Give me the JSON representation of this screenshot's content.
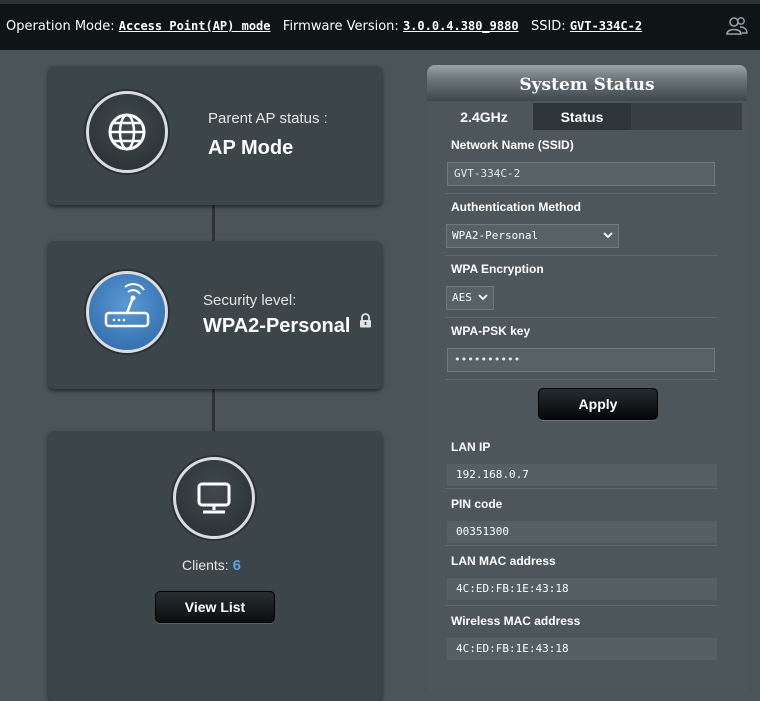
{
  "topbar": {
    "operation_mode_label": "Operation Mode:",
    "operation_mode_value": "Access Point(AP) mode",
    "firmware_label": "Firmware Version:",
    "firmware_value": "3.0.0.4.380_9880",
    "ssid_label": "SSID:",
    "ssid_value": "GVT-334C-2",
    "icon": "users-icon"
  },
  "parent_ap": {
    "icon": "globe-icon",
    "label": "Parent AP status :",
    "value": "AP Mode"
  },
  "security": {
    "icon": "router-icon",
    "label": "Security level:",
    "value": "WPA2-Personal",
    "lock_icon": "lock-icon"
  },
  "clients": {
    "icon": "monitor-icon",
    "label": "Clients:",
    "count": "6",
    "button_label": "View List"
  },
  "system_status": {
    "title": "System Status",
    "tabs": [
      {
        "label": "2.4GHz",
        "active": true
      },
      {
        "label": "Status",
        "active": false
      }
    ],
    "network_name_label": "Network Name (SSID)",
    "network_name_value": "GVT-334C-2",
    "auth_method_label": "Authentication Method",
    "auth_method_value": "WPA2-Personal",
    "wpa_encryption_label": "WPA Encryption",
    "wpa_encryption_value": "AES",
    "wpa_psk_label": "WPA-PSK key",
    "wpa_psk_value": "••••••••••",
    "apply_label": "Apply",
    "lan_ip_label": "LAN IP",
    "lan_ip_value": "192.168.0.7",
    "pin_label": "PIN code",
    "pin_value": "00351300",
    "lan_mac_label": "LAN MAC address",
    "lan_mac_value": "4C:ED:FB:1E:43:18",
    "wireless_mac_label": "Wireless MAC address",
    "wireless_mac_value": "4C:ED:FB:1E:43:18"
  },
  "colors": {
    "background": "#4b5559",
    "topbar": "#0f1416",
    "accent_blue": "#5ba3e4"
  }
}
